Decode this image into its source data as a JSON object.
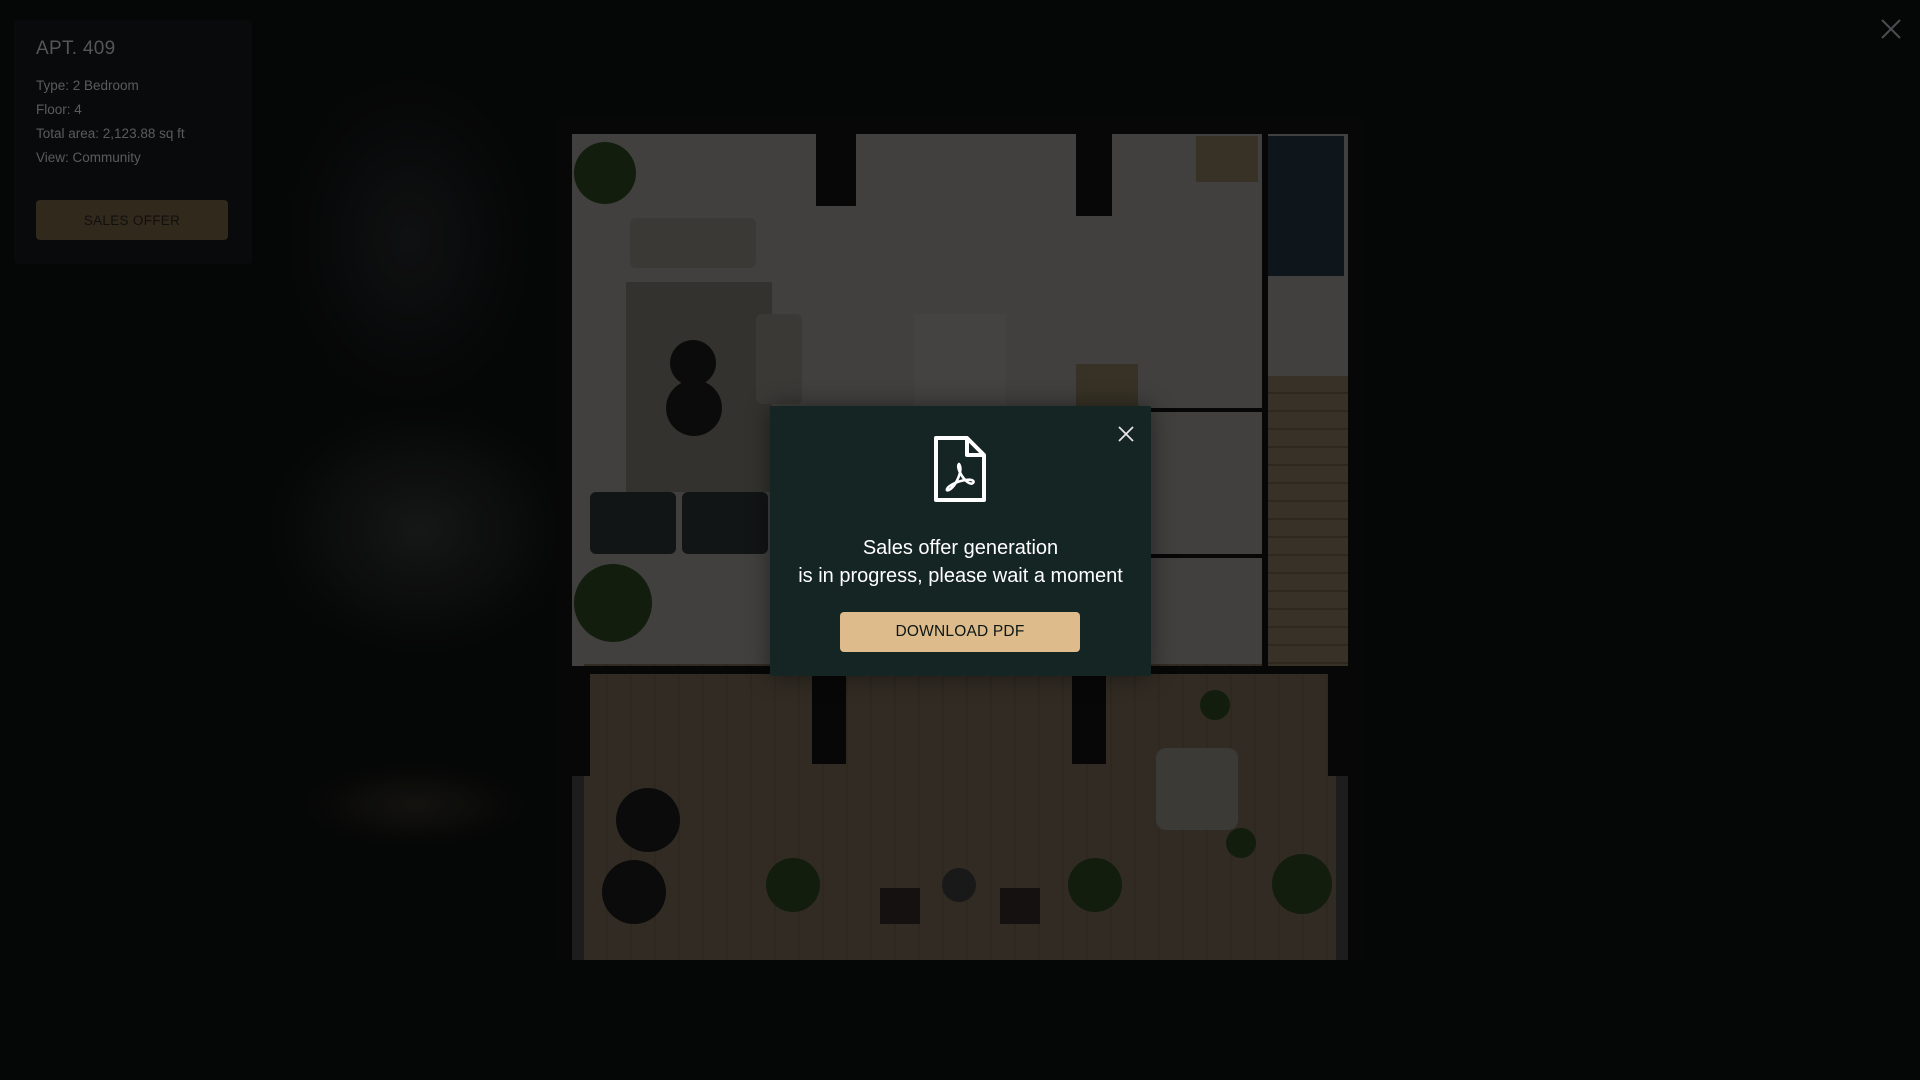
{
  "apartment": {
    "title": "APT. 409",
    "details": [
      "Type: 2 Bedroom",
      "Floor: 4",
      "Total area: 2,123.88 sq ft",
      "View: Community"
    ],
    "sales_offer_label": "SALES OFFER"
  },
  "modal": {
    "icon": "pdf-document-icon",
    "message_line1": "Sales offer generation",
    "message_line2": "is in progress, please wait a moment",
    "download_label": "DOWNLOAD PDF",
    "close_icon": "close-icon"
  },
  "page": {
    "close_icon": "close-icon"
  },
  "colors": {
    "modal_bg": "#152523",
    "accent": "#ddbb8b",
    "panel_bg": "#0b0c0d"
  }
}
